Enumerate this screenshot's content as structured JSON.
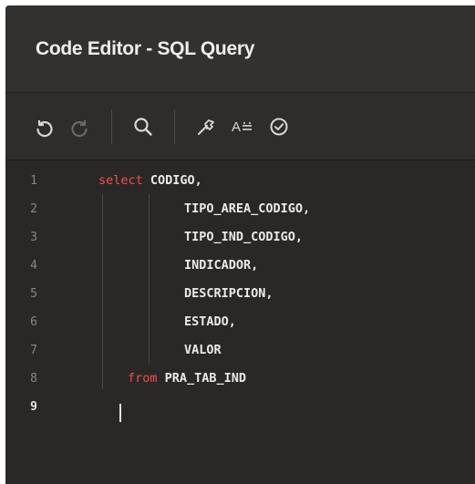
{
  "window": {
    "title": "Code Editor - SQL Query"
  },
  "toolbar": {
    "buttons": [
      {
        "name": "undo",
        "icon": "undo-icon"
      },
      {
        "name": "redo",
        "icon": "redo-icon"
      },
      {
        "name": "search",
        "icon": "search-icon"
      },
      {
        "name": "validate",
        "icon": "hammer-icon"
      },
      {
        "name": "format",
        "icon": "format-text-icon",
        "label": "A"
      },
      {
        "name": "run",
        "icon": "check-circle-icon"
      }
    ]
  },
  "editor": {
    "language": "SQL",
    "active_line": 9,
    "lines": [
      {
        "num": "1",
        "keyword": "select",
        "text": " CODIGO,"
      },
      {
        "num": "2",
        "keyword": "",
        "text": "TIPO_AREA_CODIGO,"
      },
      {
        "num": "3",
        "keyword": "",
        "text": "TIPO_IND_CODIGO,"
      },
      {
        "num": "4",
        "keyword": "",
        "text": "INDICADOR,"
      },
      {
        "num": "5",
        "keyword": "",
        "text": "DESCRIPCION,"
      },
      {
        "num": "6",
        "keyword": "",
        "text": "ESTADO,"
      },
      {
        "num": "7",
        "keyword": "",
        "text": "VALOR"
      },
      {
        "num": "8",
        "keyword": "from",
        "text": " PRA_TAB_IND"
      },
      {
        "num": "9",
        "keyword": "",
        "text": ""
      }
    ]
  },
  "colors": {
    "background": "#2a2827",
    "header": "#333130",
    "keyword": "#ef4f4f",
    "text": "#eceae8",
    "line_number": "#8a8684"
  }
}
